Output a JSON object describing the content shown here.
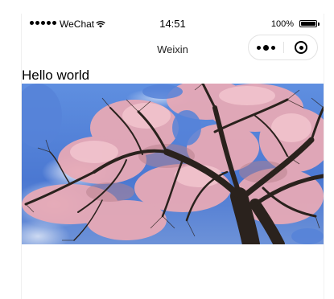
{
  "status_bar": {
    "carrier": "WeChat",
    "time": "14:51",
    "battery_percent": "100%",
    "battery_level": 1.0,
    "icons": [
      "signal-dots-icon",
      "wifi-icon",
      "battery-icon"
    ]
  },
  "nav_bar": {
    "title": "Weixin",
    "capsule_icons": [
      "more-menu-icon",
      "close-circle-icon"
    ]
  },
  "content": {
    "heading": "Hello world",
    "image": "cherry-blossom-tree-photo"
  },
  "colors": {
    "sky": "#4f7fd6",
    "blossom": "#e8a7b4",
    "branch": "#2a221d"
  }
}
